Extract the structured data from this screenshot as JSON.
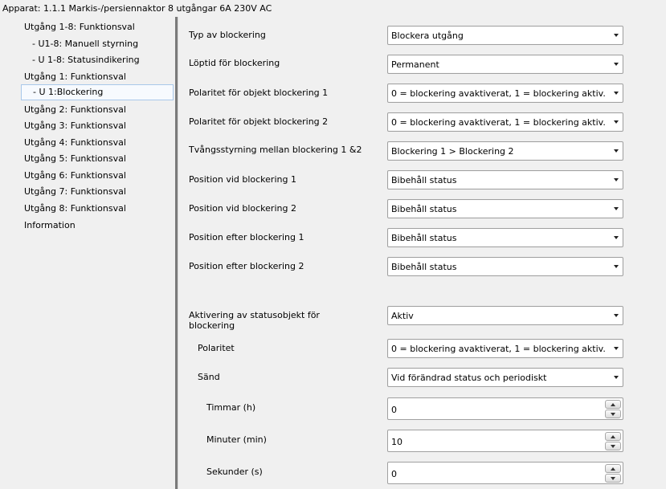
{
  "window": {
    "title": "Apparat: 1.1.1  Markis-/persiennaktor 8 utgångar 6A 230V AC"
  },
  "sidebar": {
    "items": [
      {
        "label": "Utgång 1-8: Funktionsval"
      },
      {
        "label": "- U1-8: Manuell styrning"
      },
      {
        "label": "- U 1-8: Statusindikering"
      },
      {
        "label": "Utgång 1: Funktionsval"
      },
      {
        "label": "- U 1:Blockering"
      },
      {
        "label": "Utgång 2: Funktionsval"
      },
      {
        "label": "Utgång 3: Funktionsval"
      },
      {
        "label": "Utgång 4: Funktionsval"
      },
      {
        "label": "Utgång 5: Funktionsval"
      },
      {
        "label": "Utgång 6: Funktionsval"
      },
      {
        "label": "Utgång 7: Funktionsval"
      },
      {
        "label": "Utgång 8: Funktionsval"
      },
      {
        "label": "Information"
      }
    ],
    "selected_item": "- U 1:Blockering"
  },
  "params": [
    {
      "label": "Typ av blockering",
      "value": "Blockera utgång"
    },
    {
      "label": "Löptid för blockering",
      "value": "Permanent"
    },
    {
      "label": "Polaritet för objekt blockering 1",
      "value": "0 = blockering avaktiverat, 1 = blockering aktiv."
    },
    {
      "label": "Polaritet för objekt blockering 2",
      "value": "0 = blockering avaktiverat, 1 = blockering aktiv."
    },
    {
      "label": "Tvångsstyrning mellan blockering 1 &2",
      "value": "Blockering 1 > Blockering 2"
    },
    {
      "label": "Position vid blockering 1",
      "value": "Bibehåll status"
    },
    {
      "label": "Position vid blockering 2",
      "value": "Bibehåll status"
    },
    {
      "label": "Position efter blockering 1",
      "value": "Bibehåll status"
    },
    {
      "label": "Position efter blockering 2",
      "value": "Bibehåll status"
    },
    {
      "label": "Aktivering av statusobjekt för blockering",
      "value": "Aktiv"
    },
    {
      "label": "Polaritet",
      "value": "0 = blockering avaktiverat, 1 = blockering aktiv."
    },
    {
      "label": "Sänd",
      "value": "Vid förändrad status och periodiskt"
    }
  ],
  "spinners": [
    {
      "label": "Timmar (h)",
      "value": "0"
    },
    {
      "label": "Minuter (min)",
      "value": "10"
    },
    {
      "label": "Sekunder (s)",
      "value": "0"
    }
  ],
  "icons": {
    "dropdown": "chevron-down-icon",
    "spin_up": "spin-up-icon",
    "spin_down": "spin-down-icon"
  },
  "colors": {
    "selection_border": "#a9c8ea",
    "selection_fill": "#f7fafe",
    "splitter": "#7a7a7a"
  }
}
